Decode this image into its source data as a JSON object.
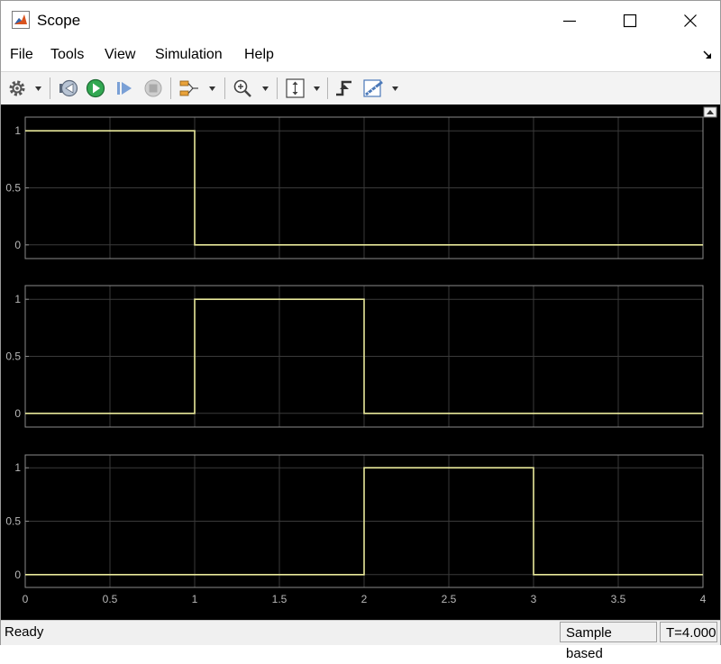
{
  "window": {
    "title": "Scope"
  },
  "menu": {
    "items": [
      "File",
      "Tools",
      "View",
      "Simulation",
      "Help"
    ]
  },
  "toolbar": {
    "buttons": [
      "settings-icon",
      "step-back-icon",
      "run-icon",
      "step-forward-icon",
      "stop-icon",
      "signal-selector-icon",
      "zoom-in-icon",
      "scale-axes-icon",
      "triggers-icon",
      "measurements-icon"
    ]
  },
  "chart_data": [
    {
      "type": "line",
      "title": "",
      "xlabel": "",
      "ylabel": "",
      "x": [
        0,
        1,
        1,
        4
      ],
      "y": [
        1,
        1,
        0,
        0
      ],
      "xlim": [
        0,
        4
      ],
      "ylim": [
        -0.12,
        1.12
      ],
      "xticks": [
        "0",
        "0.5",
        "1",
        "1.5",
        "2",
        "2.5",
        "3",
        "3.5",
        "4"
      ],
      "yticks": [
        "0",
        "0.5",
        "1"
      ],
      "show_xtick_labels": false,
      "color": "#e8e89a",
      "grid": true
    },
    {
      "type": "line",
      "title": "",
      "xlabel": "",
      "ylabel": "",
      "x": [
        0,
        1,
        1,
        2,
        2,
        4
      ],
      "y": [
        0,
        0,
        1,
        1,
        0,
        0
      ],
      "xlim": [
        0,
        4
      ],
      "ylim": [
        -0.12,
        1.12
      ],
      "xticks": [
        "0",
        "0.5",
        "1",
        "1.5",
        "2",
        "2.5",
        "3",
        "3.5",
        "4"
      ],
      "yticks": [
        "0",
        "0.5",
        "1"
      ],
      "show_xtick_labels": false,
      "color": "#e8e89a",
      "grid": true
    },
    {
      "type": "line",
      "title": "",
      "xlabel": "",
      "ylabel": "",
      "x": [
        0,
        2,
        2,
        3,
        3,
        4
      ],
      "y": [
        0,
        0,
        1,
        1,
        0,
        0
      ],
      "xlim": [
        0,
        4
      ],
      "ylim": [
        -0.12,
        1.12
      ],
      "xticks": [
        "0",
        "0.5",
        "1",
        "1.5",
        "2",
        "2.5",
        "3",
        "3.5",
        "4"
      ],
      "yticks": [
        "0",
        "0.5",
        "1"
      ],
      "show_xtick_labels": true,
      "color": "#e8e89a",
      "grid": true
    }
  ],
  "status": {
    "left": "Ready",
    "mode": "Sample based",
    "time": "T=4.000"
  }
}
